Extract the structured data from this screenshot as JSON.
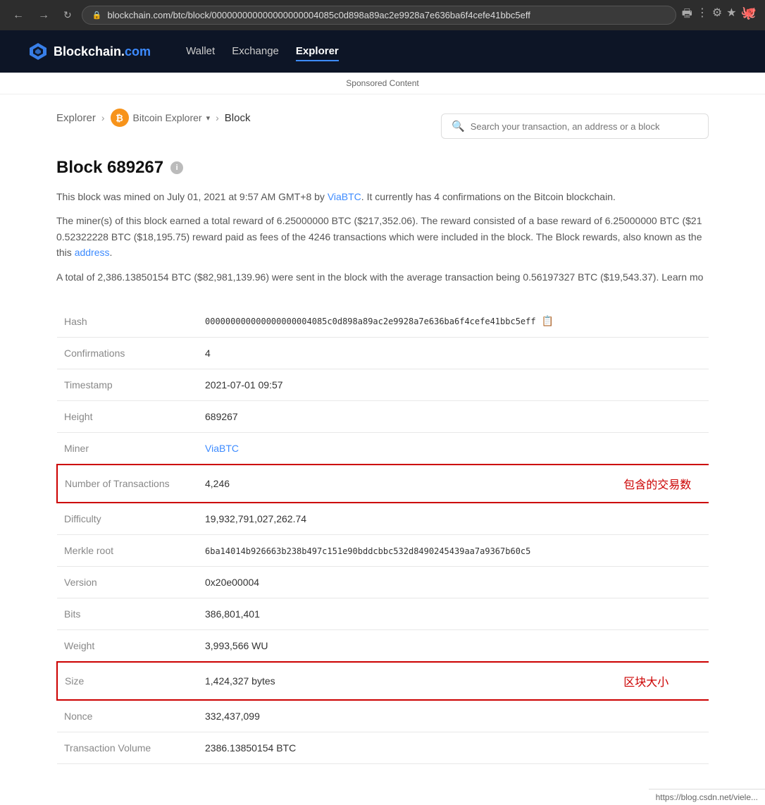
{
  "browser": {
    "url": "blockchain.com/btc/block/000000000000000000004085c0d898a89ac2e9928a7e636ba6f4cefe41bbc5eff",
    "emoji": "🐙"
  },
  "nav": {
    "brand": "Blockchain",
    "brand_dot": ".",
    "brand_com": "com",
    "wallet": "Wallet",
    "exchange": "Exchange",
    "explorer": "Explorer",
    "sponsored": "Sponsored Content"
  },
  "breadcrumb": {
    "explorer": "Explorer",
    "bitcoin_explorer": "Bitcoin Explorer",
    "block": "Block"
  },
  "search": {
    "placeholder": "Search your transaction, an address or a block"
  },
  "page": {
    "title": "Block 689267",
    "desc1": "This block was mined on July 01, 2021 at 9:57 AM GMT+8 by ViaBTC. It currently has 4 confirmations on the Bitcoin blockchain.",
    "desc2": "The miner(s) of this block earned a total reward of 6.25000000 BTC ($217,352.06). The reward consisted of a base reward of 6.25000000 BTC ($21 0.52322228 BTC ($18,195.75) reward paid as fees of the 4246 transactions which were included in the block. The Block rewards, also known as the this address.",
    "desc3": "A total of 2,386.13850154 BTC ($82,981,139.96) were sent in the block with the average transaction being 0.56197327 BTC ($19,543.37).  Learn mo"
  },
  "table": {
    "rows": [
      {
        "label": "Hash",
        "value": "000000000000000000004085c0d898a89ac2e9928a7e636ba6f4cefe41bbc5eff",
        "type": "hash",
        "highlight": false,
        "annotation": ""
      },
      {
        "label": "Confirmations",
        "value": "4",
        "type": "text",
        "highlight": false,
        "annotation": ""
      },
      {
        "label": "Timestamp",
        "value": "2021-07-01 09:57",
        "type": "text",
        "highlight": false,
        "annotation": ""
      },
      {
        "label": "Height",
        "value": "689267",
        "type": "text",
        "highlight": false,
        "annotation": ""
      },
      {
        "label": "Miner",
        "value": "ViaBTC",
        "type": "link",
        "highlight": false,
        "annotation": ""
      },
      {
        "label": "Number of Transactions",
        "value": "4,246",
        "type": "text",
        "highlight": true,
        "annotation": "包含的交易数"
      },
      {
        "label": "Difficulty",
        "value": "19,932,791,027,262.74",
        "type": "text",
        "highlight": false,
        "annotation": ""
      },
      {
        "label": "Merkle root",
        "value": "6ba14014b926663b238b497c151e90bddcbbc532d8490245439aa7a9367b60c5",
        "type": "mono",
        "highlight": false,
        "annotation": ""
      },
      {
        "label": "Version",
        "value": "0x20e00004",
        "type": "text",
        "highlight": false,
        "annotation": ""
      },
      {
        "label": "Bits",
        "value": "386,801,401",
        "type": "text",
        "highlight": false,
        "annotation": ""
      },
      {
        "label": "Weight",
        "value": "3,993,566 WU",
        "type": "text",
        "highlight": false,
        "annotation": ""
      },
      {
        "label": "Size",
        "value": "1,424,327 bytes",
        "type": "text",
        "highlight": true,
        "annotation": "区块大小"
      },
      {
        "label": "Nonce",
        "value": "332,437,099",
        "type": "text",
        "highlight": false,
        "annotation": ""
      },
      {
        "label": "Transaction Volume",
        "value": "2386.13850154 BTC",
        "type": "text",
        "highlight": false,
        "annotation": ""
      }
    ]
  },
  "footer_link": "https://blog.csdn.net/viele..."
}
